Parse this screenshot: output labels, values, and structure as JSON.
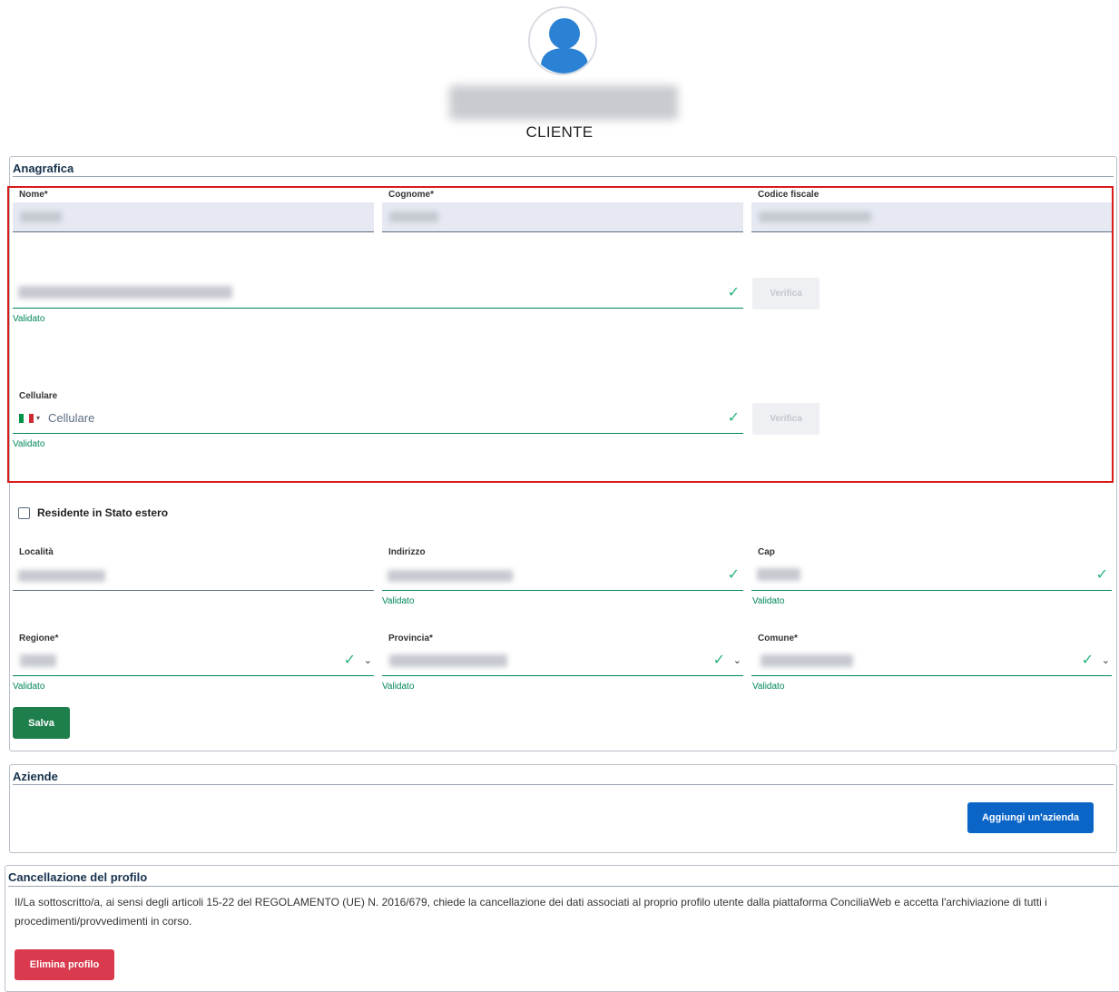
{
  "header": {
    "role": "CLIENTE"
  },
  "anagrafica": {
    "title": "Anagrafica",
    "nome_label": "Nome*",
    "cognome_label": "Cognome*",
    "codice_fiscale_label": "Codice fiscale",
    "email_validated": "Validato",
    "verifica_label": "Verifica",
    "cellulare_label": "Cellulare",
    "cellulare_placeholder": "Cellulare",
    "cellulare_validated": "Validato",
    "residente_label": "Residente in Stato estero",
    "residente_checked": false,
    "localita_label": "Località",
    "indirizzo_label": "Indirizzo",
    "indirizzo_validated": "Validato",
    "cap_label": "Cap",
    "cap_validated": "Validato",
    "regione_label": "Regione*",
    "regione_validated": "Validato",
    "provincia_label": "Provincia*",
    "provincia_validated": "Validato",
    "comune_label": "Comune*",
    "comune_validated": "Validato",
    "save_label": "Salva"
  },
  "aziende": {
    "title": "Aziende",
    "add_label": "Aggiungi un'azienda"
  },
  "cancellazione": {
    "title": "Cancellazione del profilo",
    "text": "Il/La sottoscritto/a, ai sensi degli articoli 15-22 del REGOLAMENTO (UE) N. 2016/679, chiede la cancellazione dei dati associati al proprio profilo utente dalla piattaforma ConciliaWeb e accetta l'archiviazione di tutti i procedimenti/provvedimenti in corso.",
    "delete_label": "Elimina profilo"
  },
  "colors": {
    "validated": "#008758",
    "primary": "#0b65c7",
    "save": "#1f7f4c",
    "danger": "#d93a4e",
    "highlight": "#d81b1b"
  }
}
